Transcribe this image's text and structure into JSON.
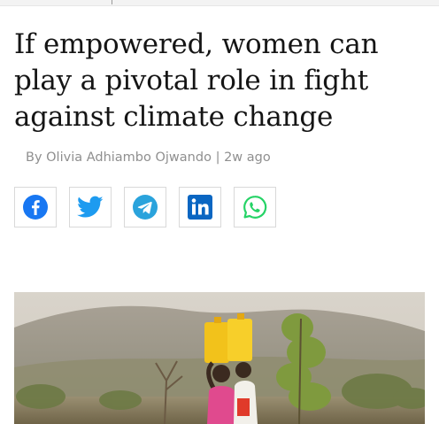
{
  "article": {
    "headline": "If empowered, women can play a pivotal role in fight against climate change",
    "author": "By Olivia Adhiambo Ojwando",
    "separator": "|",
    "published": "2w ago"
  },
  "share": {
    "buttons": [
      {
        "network": "Facebook",
        "icon": "facebook-icon",
        "color": "#1877f2"
      },
      {
        "network": "Twitter",
        "icon": "twitter-icon",
        "color": "#1d9bf0"
      },
      {
        "network": "Telegram",
        "icon": "telegram-icon",
        "color": "#2aa3dc"
      },
      {
        "network": "LinkedIn",
        "icon": "linkedin-icon",
        "color": "#0a66c2"
      },
      {
        "network": "WhatsApp",
        "icon": "whatsapp-icon",
        "color": "#25d366"
      }
    ]
  },
  "colors": {
    "headline": "#151515",
    "byline": "#8f8f8f",
    "button_border": "#d9d9d9"
  }
}
